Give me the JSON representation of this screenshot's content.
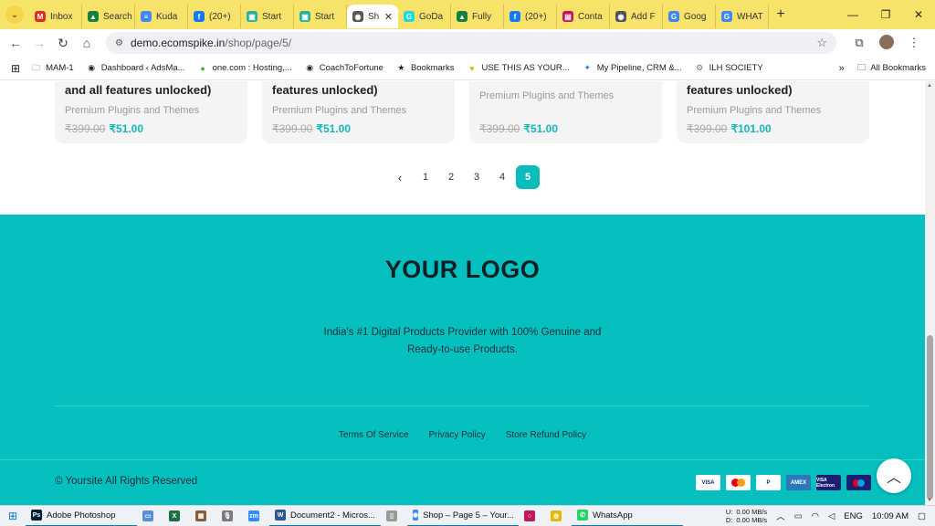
{
  "browser": {
    "tabs": [
      {
        "label": "Inbox",
        "color": "#d93025",
        "glyph": "M"
      },
      {
        "label": "Search",
        "color": "#188038",
        "glyph": "▲"
      },
      {
        "label": "Kuda",
        "color": "#4285f4",
        "glyph": "≡"
      },
      {
        "label": "(20+)",
        "color": "#1877f2",
        "glyph": "f"
      },
      {
        "label": "Start",
        "color": "#27b09a",
        "glyph": "▣"
      },
      {
        "label": "Start",
        "color": "#27b09a",
        "glyph": "▣"
      },
      {
        "label": "Sh",
        "color": "#555555",
        "glyph": "◉",
        "active": true
      },
      {
        "label": "GoDa",
        "color": "#1bdbdb",
        "glyph": "G"
      },
      {
        "label": "Fully",
        "color": "#188038",
        "glyph": "▲"
      },
      {
        "label": "(20+)",
        "color": "#1877f2",
        "glyph": "f"
      },
      {
        "label": "Conta",
        "color": "#c2185b",
        "glyph": "▤"
      },
      {
        "label": "Add F",
        "color": "#555555",
        "glyph": "◉"
      },
      {
        "label": "Goog",
        "color": "#4285f4",
        "glyph": "G"
      },
      {
        "label": "WHAT",
        "color": "#4285f4",
        "glyph": "G"
      }
    ],
    "new_tab": "+",
    "url_host": "demo.ecomspike.in",
    "url_path": "/shop/page/5/",
    "bookmarks": [
      {
        "label": "MAM-1",
        "icon": "folder-icon"
      },
      {
        "label": "Dashboard ‹ AdsMa...",
        "icon": "globe-icon"
      },
      {
        "label": "one.com : Hosting,...",
        "icon": "green-dot-icon"
      },
      {
        "label": "CoachToFortune",
        "icon": "globe-icon"
      },
      {
        "label": "Bookmarks",
        "icon": "star-icon"
      },
      {
        "label": "USE THIS AS YOUR...",
        "icon": "yellow-v-icon"
      },
      {
        "label": "My Pipeline, CRM &...",
        "icon": "pipeline-icon"
      },
      {
        "label": "ILH SOCIETY",
        "icon": "gear-icon"
      }
    ],
    "all_bookmarks": "All Bookmarks"
  },
  "products": [
    {
      "title": "and all features unlocked)",
      "category": "Premium Plugins and Themes",
      "old_price": "₹399.00",
      "new_price": "₹51.00"
    },
    {
      "title": "features unlocked)",
      "category": "Premium Plugins and Themes",
      "old_price": "₹399.00",
      "new_price": "₹51.00"
    },
    {
      "title": "",
      "category": "Premium Plugins and Themes",
      "old_price": "₹399.00",
      "new_price": "₹51.00"
    },
    {
      "title": "features unlocked)",
      "category": "Premium Plugins and Themes",
      "old_price": "₹399.00",
      "new_price": "₹101.00"
    }
  ],
  "pagination": {
    "pages": [
      "1",
      "2",
      "3",
      "4",
      "5"
    ],
    "current": "5"
  },
  "footer": {
    "logo": "YOUR LOGO",
    "tagline": "India's #1 Digital Products Provider with 100% Genuine and Ready-to-use Products.",
    "links": [
      "Terms Of Service",
      "Privacy Policy",
      "Store Refund Policy"
    ],
    "copyright": "© Yoursite All Rights Reserved",
    "payments": [
      "VISA",
      "Mastercard",
      "PayPal",
      "AMEX",
      "VISA Electron",
      "Maestro"
    ]
  },
  "taskbar": {
    "apps": [
      {
        "label": "Adobe Photoshop",
        "color": "#001e36",
        "glyph": "Ps"
      },
      {
        "label": "",
        "color": "#5b8fd8",
        "glyph": "▭"
      },
      {
        "label": "",
        "color": "#1d6f42",
        "glyph": "X"
      },
      {
        "label": "",
        "color": "#8a5a3c",
        "glyph": "▦"
      },
      {
        "label": "",
        "color": "#7a7a7a",
        "glyph": "🎙"
      },
      {
        "label": "",
        "color": "#2d8cff",
        "glyph": "zm"
      },
      {
        "label": "Document2 - Micros...",
        "color": "#2b579a",
        "glyph": "W"
      },
      {
        "label": "",
        "color": "#999999",
        "glyph": "▯"
      },
      {
        "label": "Shop – Page 5 – Your...",
        "color": "#4285f4",
        "glyph": "◉"
      },
      {
        "label": "",
        "color": "#c2185b",
        "glyph": "○"
      },
      {
        "label": "",
        "color": "#e8b900",
        "glyph": "◍"
      },
      {
        "label": "WhatsApp",
        "color": "#25d366",
        "glyph": "✆"
      }
    ],
    "upload_label": "U:",
    "download_label": "D:",
    "upload": "0.00 MB/s",
    "download": "0.00 MB/s",
    "language": "ENG",
    "time": "10:09 AM"
  }
}
